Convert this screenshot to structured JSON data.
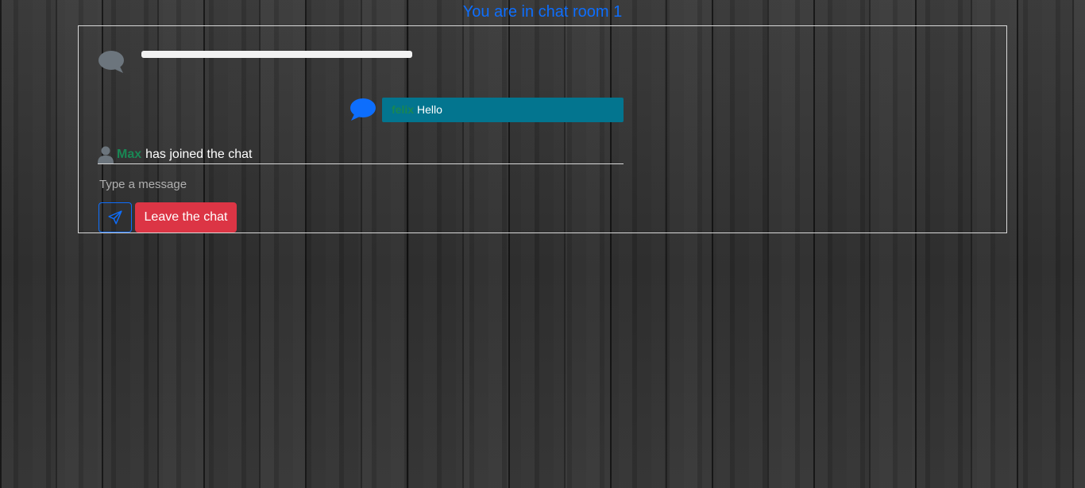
{
  "header": {
    "room_title": "You are in chat room 1"
  },
  "chat": {
    "messages": [
      {
        "type": "loading",
        "icon": "comment-icon",
        "icon_color": "#6c757d"
      },
      {
        "type": "message",
        "icon": "comment-icon",
        "icon_color": "#0d6efd",
        "sender": "felix",
        "text": "Hello",
        "bubble_color": "#03758f"
      }
    ],
    "join_notice": {
      "icon": "user-icon",
      "name": "Max",
      "text": "has joined the chat"
    }
  },
  "composer": {
    "placeholder": "Type a message",
    "value": "",
    "send_icon": "paper-plane-icon",
    "leave_label": "Leave the chat"
  },
  "colors": {
    "primary": "#0d6efd",
    "success": "#198754",
    "danger": "#dc3545",
    "message_bubble": "#03758f",
    "muted_icon": "#6c757d"
  }
}
